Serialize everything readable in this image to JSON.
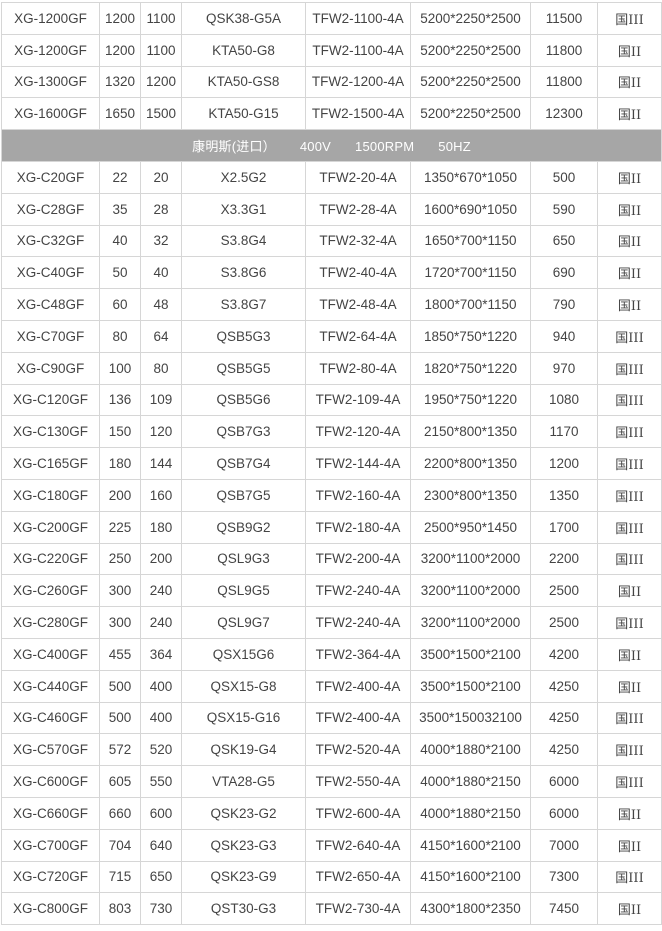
{
  "table": {
    "rows_before": [
      [
        "XG-1200GF",
        "1200",
        "1100",
        "QSK38-G5A",
        "TFW2-1100-4A",
        "5200*2250*2500",
        "11500",
        "国III"
      ],
      [
        "XG-1200GF",
        "1200",
        "1100",
        "KTA50-G8",
        "TFW2-1100-4A",
        "5200*2250*2500",
        "11800",
        "国II"
      ],
      [
        "XG-1300GF",
        "1320",
        "1200",
        "KTA50-GS8",
        "TFW2-1200-4A",
        "5200*2250*2500",
        "11800",
        "国II"
      ],
      [
        "XG-1600GF",
        "1650",
        "1500",
        "KTA50-G15",
        "TFW2-1500-4A",
        "5200*2250*2500",
        "12300",
        "国II"
      ]
    ],
    "group_header": {
      "brand": "康明斯(进口）",
      "voltage": "400V",
      "speed": "1500RPM",
      "frequency": "50HZ"
    },
    "rows_after": [
      [
        "XG-C20GF",
        "22",
        "20",
        "X2.5G2",
        "TFW2-20-4A",
        "1350*670*1050",
        "500",
        "国II"
      ],
      [
        "XG-C28GF",
        "35",
        "28",
        "X3.3G1",
        "TFW2-28-4A",
        "1600*690*1050",
        "590",
        "国II"
      ],
      [
        "XG-C32GF",
        "40",
        "32",
        "S3.8G4",
        "TFW2-32-4A",
        "1650*700*1150",
        "650",
        "国II"
      ],
      [
        "XG-C40GF",
        "50",
        "40",
        "S3.8G6",
        "TFW2-40-4A",
        "1720*700*1150",
        "690",
        "国II"
      ],
      [
        "XG-C48GF",
        "60",
        "48",
        "S3.8G7",
        "TFW2-48-4A",
        "1800*700*1150",
        "790",
        "国II"
      ],
      [
        "XG-C70GF",
        "80",
        "64",
        "QSB5G3",
        "TFW2-64-4A",
        "1850*750*1220",
        "940",
        "国III"
      ],
      [
        "XG-C90GF",
        "100",
        "80",
        "QSB5G5",
        "TFW2-80-4A",
        "1820*750*1220",
        "970",
        "国III"
      ],
      [
        "XG-C120GF",
        "136",
        "109",
        "QSB5G6",
        "TFW2-109-4A",
        "1950*750*1220",
        "1080",
        "国III"
      ],
      [
        "XG-C130GF",
        "150",
        "120",
        "QSB7G3",
        "TFW2-120-4A",
        "2150*800*1350",
        "1170",
        "国III"
      ],
      [
        "XG-C165GF",
        "180",
        "144",
        "QSB7G4",
        "TFW2-144-4A",
        "2200*800*1350",
        "1200",
        "国III"
      ],
      [
        "XG-C180GF",
        "200",
        "160",
        "QSB7G5",
        "TFW2-160-4A",
        "2300*800*1350",
        "1350",
        "国III"
      ],
      [
        "XG-C200GF",
        "225",
        "180",
        "QSB9G2",
        "TFW2-180-4A",
        "2500*950*1450",
        "1700",
        "国III"
      ],
      [
        "XG-C220GF",
        "250",
        "200",
        "QSL9G3",
        "TFW2-200-4A",
        "3200*1100*2000",
        "2200",
        "国III"
      ],
      [
        "XG-C260GF",
        "300",
        "240",
        "QSL9G5",
        "TFW2-240-4A",
        "3200*1100*2000",
        "2500",
        "国II"
      ],
      [
        "XG-C280GF",
        "300",
        "240",
        "QSL9G7",
        "TFW2-240-4A",
        "3200*1100*2000",
        "2500",
        "国III"
      ],
      [
        "XG-C400GF",
        "455",
        "364",
        "QSX15G6",
        "TFW2-364-4A",
        "3500*1500*2100",
        "4200",
        "国II"
      ],
      [
        "XG-C440GF",
        "500",
        "400",
        "QSX15-G8",
        "TFW2-400-4A",
        "3500*1500*2100",
        "4250",
        "国II"
      ],
      [
        "XG-C460GF",
        "500",
        "400",
        "QSX15-G16",
        "TFW2-400-4A",
        "3500*150032100",
        "4250",
        "国III"
      ],
      [
        "XG-C570GF",
        "572",
        "520",
        "QSK19-G4",
        "TFW2-520-4A",
        "4000*1880*2100",
        "4250",
        "国III"
      ],
      [
        "XG-C600GF",
        "605",
        "550",
        "VTA28-G5",
        "TFW2-550-4A",
        "4000*1880*2150",
        "6000",
        "国III"
      ],
      [
        "XG-C660GF",
        "660",
        "600",
        "QSK23-G2",
        "TFW2-600-4A",
        "4000*1880*2150",
        "6000",
        "国II"
      ],
      [
        "XG-C700GF",
        "704",
        "640",
        "QSK23-G3",
        "TFW2-640-4A",
        "4150*1600*2100",
        "7000",
        "国II"
      ],
      [
        "XG-C720GF",
        "715",
        "650",
        "QSK23-G9",
        "TFW2-650-4A",
        "4150*1600*2100",
        "7300",
        "国III"
      ],
      [
        "XG-C800GF",
        "803",
        "730",
        "QST30-G3",
        "TFW2-730-4A",
        "4300*1800*2350",
        "7450",
        "国II"
      ]
    ]
  }
}
